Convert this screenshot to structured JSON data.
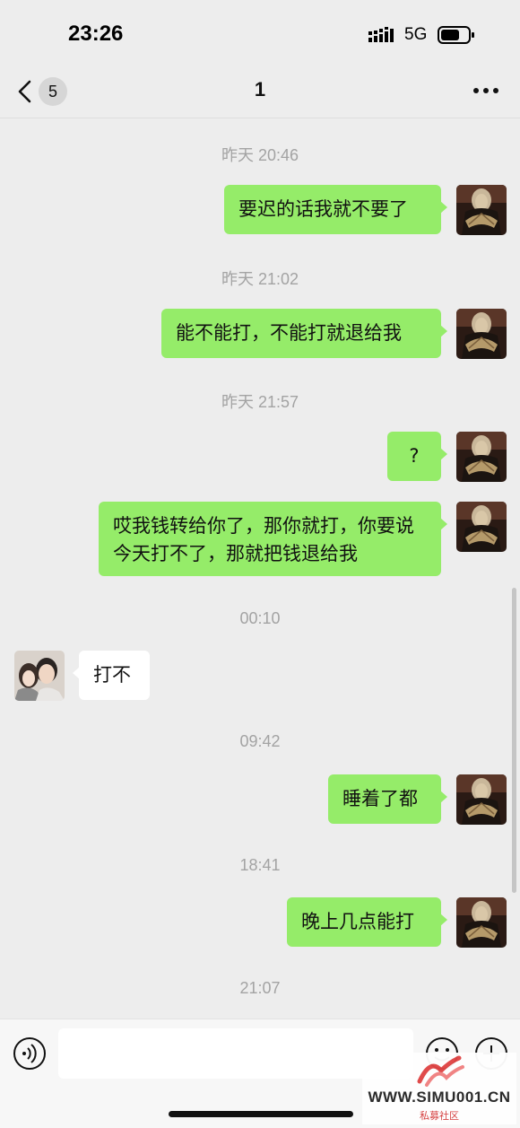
{
  "status_bar": {
    "time": "23:26",
    "network": "5G",
    "icons": [
      "signal-icon",
      "battery-icon"
    ]
  },
  "nav": {
    "unread_count": "5",
    "title": "1",
    "icons": [
      "back-chevron-icon",
      "more-dots-icon"
    ]
  },
  "messages": [
    {
      "type": "timestamp",
      "text": "昨天 20:46"
    },
    {
      "type": "outgoing",
      "text": "要迟的话我就不要了"
    },
    {
      "type": "timestamp",
      "text": "昨天 21:02"
    },
    {
      "type": "outgoing",
      "text": "能不能打，不能打就退给我"
    },
    {
      "type": "timestamp",
      "text": "昨天 21:57"
    },
    {
      "type": "outgoing",
      "text": "?"
    },
    {
      "type": "outgoing",
      "text": "哎我钱转给你了，那你就打，你要说今天打不了，那就把钱退给我"
    },
    {
      "type": "timestamp",
      "text": "00:10"
    },
    {
      "type": "incoming",
      "text": "打不"
    },
    {
      "type": "timestamp",
      "text": "09:42"
    },
    {
      "type": "outgoing",
      "text": "睡着了都"
    },
    {
      "type": "timestamp",
      "text": "18:41"
    },
    {
      "type": "outgoing",
      "text": "晚上几点能打"
    },
    {
      "type": "timestamp",
      "text": "21:07"
    }
  ],
  "input_bar": {
    "message_value": "",
    "icons": [
      "voice-icon",
      "emoji-icon",
      "plus-icon"
    ]
  },
  "watermark": {
    "url": "WWW.SIMU001.CN",
    "subtitle": "私募社区"
  },
  "colors": {
    "background": "#ededed",
    "outgoing_bubble": "#95ec69",
    "incoming_bubble": "#ffffff",
    "timestamp": "#a3a3a3"
  }
}
